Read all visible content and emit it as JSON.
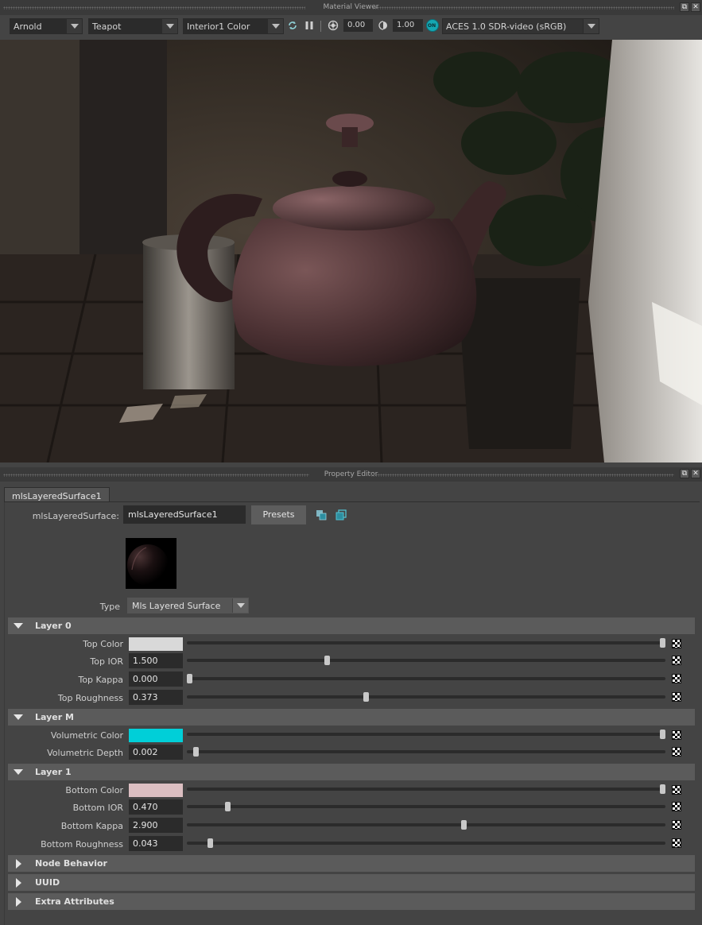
{
  "material_viewer": {
    "title": "Material Viewer",
    "renderer": "Arnold",
    "shape": "Teapot",
    "environment": "Interior1 Color",
    "exposure": "0.00",
    "gamma": "1.00",
    "color_management": "ACES 1.0 SDR-video (sRGB)",
    "color_management_badge": "ON"
  },
  "property_editor": {
    "title": "Property Editor",
    "tab": "mlsLayeredSurface1",
    "node_label": "mlsLayeredSurface:",
    "node_name": "mlsLayeredSurface1",
    "presets_label": "Presets",
    "type_label": "Type",
    "type_value": "Mls Layered Surface",
    "sections": [
      {
        "title": "Layer 0",
        "expanded": true,
        "attributes": [
          {
            "label": "Top Color",
            "kind": "color",
            "color": "#d9d9d9",
            "slider": 1.0
          },
          {
            "label": "Top IOR",
            "kind": "number",
            "value": "1.500",
            "slider": 0.29
          },
          {
            "label": "Top Kappa",
            "kind": "number",
            "value": "0.000",
            "slider": 0.0
          },
          {
            "label": "Top Roughness",
            "kind": "number",
            "value": "0.373",
            "slider": 0.373
          }
        ]
      },
      {
        "title": "Layer M",
        "expanded": true,
        "attributes": [
          {
            "label": "Volumetric Color",
            "kind": "color",
            "color": "#00cfd8",
            "slider": 1.0
          },
          {
            "label": "Volumetric Depth",
            "kind": "number",
            "value": "0.002",
            "slider": 0.013
          }
        ]
      },
      {
        "title": "Layer 1",
        "expanded": true,
        "attributes": [
          {
            "label": "Bottom Color",
            "kind": "color",
            "color": "#dbbec1",
            "slider": 1.0
          },
          {
            "label": "Bottom IOR",
            "kind": "number",
            "value": "0.470",
            "slider": 0.08
          },
          {
            "label": "Bottom Kappa",
            "kind": "number",
            "value": "2.900",
            "slider": 0.58
          },
          {
            "label": "Bottom Roughness",
            "kind": "number",
            "value": "0.043",
            "slider": 0.043
          }
        ]
      },
      {
        "title": "Node Behavior",
        "expanded": false,
        "attributes": []
      },
      {
        "title": "UUID",
        "expanded": false,
        "attributes": []
      },
      {
        "title": "Extra Attributes",
        "expanded": false,
        "attributes": []
      }
    ]
  },
  "icons": [
    "refresh-render-icon",
    "pause-icon",
    "exposure-icon",
    "gamma-icon",
    "color-management-icon",
    "load-preset-icon",
    "copy-tab-icon",
    "restore-icon",
    "close-icon",
    "map-texture-icon"
  ]
}
